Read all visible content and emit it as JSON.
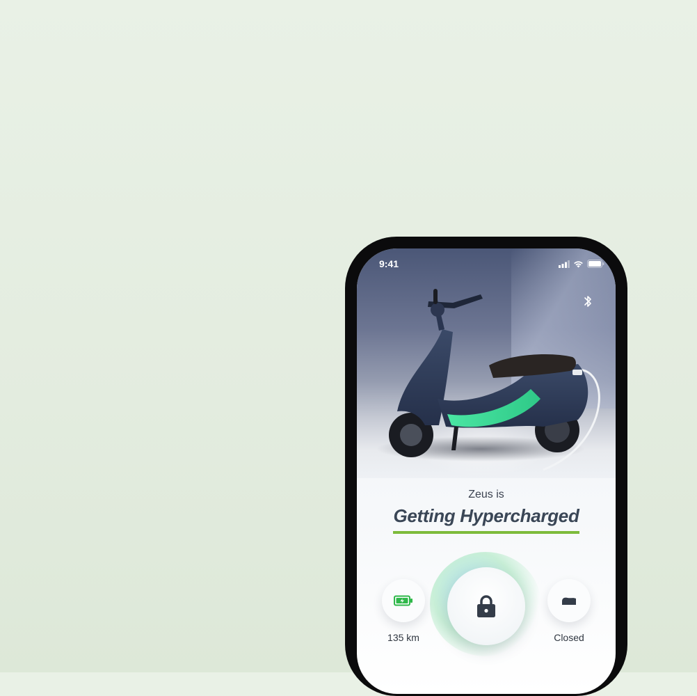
{
  "status_bar": {
    "time": "9:41"
  },
  "hero": {
    "scooter_name_prefix": "Zeus is",
    "status_headline": "Getting Hypercharged"
  },
  "controls": {
    "range_label": "135 km",
    "lock_state": "locked",
    "boot_label": "Closed"
  },
  "colors": {
    "accent_underline": "#7dbb3b",
    "battery_green": "#2fb84a",
    "headline": "#3a4656"
  },
  "icons": [
    "bluetooth-icon",
    "battery-charging-icon",
    "lock-icon",
    "boot-icon",
    "signal-icon",
    "wifi-icon",
    "battery-status-icon"
  ]
}
